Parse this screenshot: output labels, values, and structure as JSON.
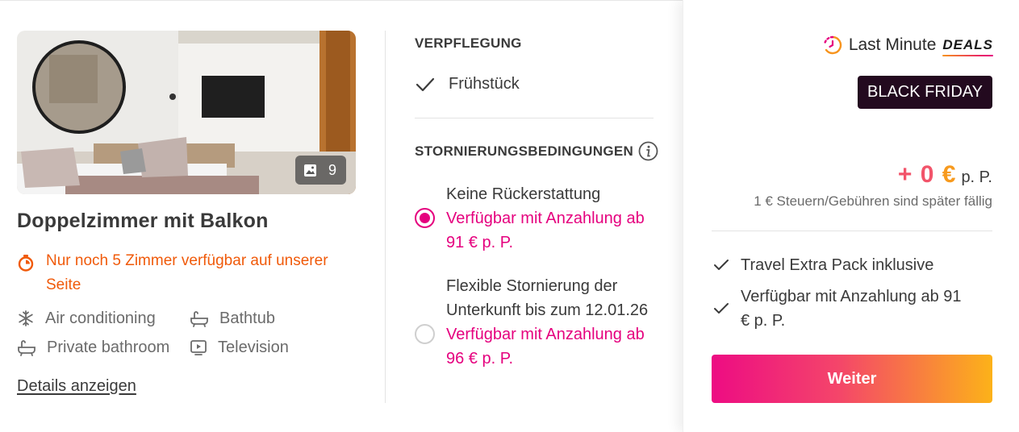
{
  "room": {
    "title": "Doppelzimmer mit Balkon",
    "photo_count": "9",
    "urgency": "Nur noch 5 Zimmer verfügbar auf unserer Seite",
    "amenities": [
      "Air conditioning",
      "Bathtub",
      "Private bathroom",
      "Television"
    ],
    "details_link": "Details anzeigen"
  },
  "board": {
    "heading": "VERPFLEGUNG",
    "value": "Frühstück"
  },
  "cancellation": {
    "heading": "STORNIERUNGSBEDINGUNGEN",
    "options": [
      {
        "label": "Keine Rückerstattung",
        "availability": "Verfügbar mit Anzahlung ab 91 € p. P.",
        "selected": true
      },
      {
        "label": "Flexible Stornierung der Unterkunft bis zum 12.01.26",
        "availability": "Verfügbar mit Anzahlung ab 96 € p. P.",
        "selected": false
      }
    ]
  },
  "panel": {
    "last_minute": "Last Minute",
    "deals": "DEALS",
    "black_friday": "BLACK FRIDAY",
    "price_prefix": "+ 0",
    "currency": "€",
    "per_person": "p. P.",
    "tax_note": "1 € Steuern/Gebühren sind später fällig",
    "features": [
      "Travel Extra Pack inklusive",
      "Verfügbar mit Anzahlung ab 91 € p. P."
    ],
    "cta": "Weiter"
  },
  "colors": {
    "accent_pink": "#e5007e",
    "urgency_orange": "#f05a0a",
    "badge_dark": "#230a1f",
    "cta_gradient_start": "#ed0c83",
    "cta_gradient_end": "#fcb219"
  }
}
